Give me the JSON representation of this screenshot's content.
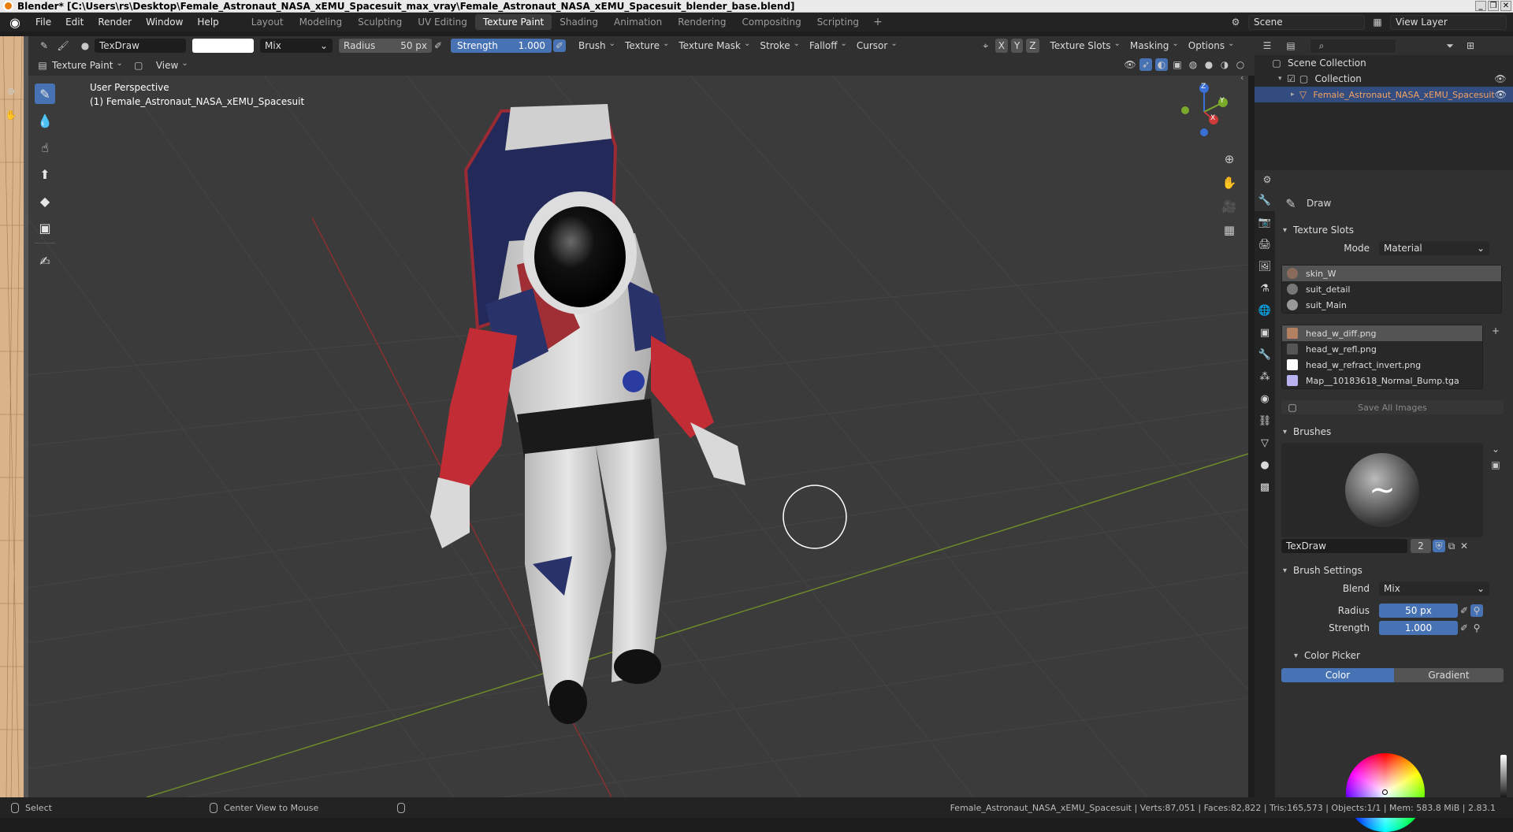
{
  "window": {
    "title": "Blender* [C:\\Users\\rs\\Desktop\\Female_Astronaut_NASA_xEMU_Spacesuit_max_vray\\Female_Astronaut_NASA_xEMU_Spacesuit_blender_base.blend]",
    "controls": [
      "_",
      "❐",
      "✕"
    ]
  },
  "menu": [
    "File",
    "Edit",
    "Render",
    "Window",
    "Help"
  ],
  "workspaces": {
    "tabs": [
      "Layout",
      "Modeling",
      "Sculpting",
      "UV Editing",
      "Texture Paint",
      "Shading",
      "Animation",
      "Rendering",
      "Compositing",
      "Scripting"
    ],
    "active": "Texture Paint",
    "add": "+"
  },
  "scene": {
    "name": "Scene",
    "view_layer": "View Layer"
  },
  "tool_header": {
    "brush_name": "TexDraw",
    "blend": "Mix",
    "radius_label": "Radius",
    "radius_value": "50 px",
    "strength_label": "Strength",
    "strength_value": "1.000",
    "menus": [
      "Brush",
      "Texture",
      "Texture Mask",
      "Stroke",
      "Falloff",
      "Cursor"
    ],
    "axes": [
      "X",
      "Y",
      "Z"
    ],
    "right_menus": [
      "Texture Slots",
      "Masking",
      "Options"
    ],
    "mode": "Texture Paint",
    "view": "View",
    "color_hex": "#ffffff"
  },
  "viewport": {
    "perspective": "User Perspective",
    "object_label": "(1) Female_Astronaut_NASA_xEMU_Spacesuit",
    "background": "#3b3b3b",
    "gizmo": {
      "z": "Z",
      "y": "Y",
      "x": "X"
    }
  },
  "tools": [
    "draw-brush-icon",
    "soften-icon",
    "smear-icon",
    "clone-icon",
    "fill-icon",
    "mask-icon",
    "annotate-icon"
  ],
  "outliner": {
    "root": "Scene Collection",
    "collection": "Collection",
    "object": "Female_Astronaut_NASA_xEMU_Spacesuit"
  },
  "properties": {
    "tool_name": "Draw",
    "texture_slots": {
      "title": "Texture Slots",
      "mode_label": "Mode",
      "mode_value": "Material",
      "materials": [
        "skin_W",
        "suit_detail",
        "suit_Main"
      ],
      "images": [
        {
          "name": "head_w_diff.png",
          "color": "#b08060"
        },
        {
          "name": "head_w_refl.png",
          "color": "#555555"
        },
        {
          "name": "head_w_refract_invert.png",
          "color": "#ffffff"
        },
        {
          "name": "Map__10183618_Normal_Bump.tga",
          "color": "#b9b2f0"
        }
      ],
      "save_all": "Save All Images"
    },
    "brushes": {
      "title": "Brushes",
      "name": "TexDraw",
      "users": "2"
    },
    "brush_settings": {
      "title": "Brush Settings",
      "blend_label": "Blend",
      "blend_value": "Mix",
      "radius_label": "Radius",
      "radius_value": "50 px",
      "strength_label": "Strength",
      "strength_value": "1.000"
    },
    "color_picker": {
      "title": "Color Picker",
      "tabs": [
        "Color",
        "Gradient"
      ],
      "active": "Color"
    }
  },
  "statusbar": {
    "left": "Select",
    "middle": "Center View to Mouse",
    "right": "Female_Astronaut_NASA_xEMU_Spacesuit | Verts:87,051 | Faces:82,822 | Tris:165,573 | Objects:1/1 | Mem: 583.8 MiB | 2.83.1"
  }
}
